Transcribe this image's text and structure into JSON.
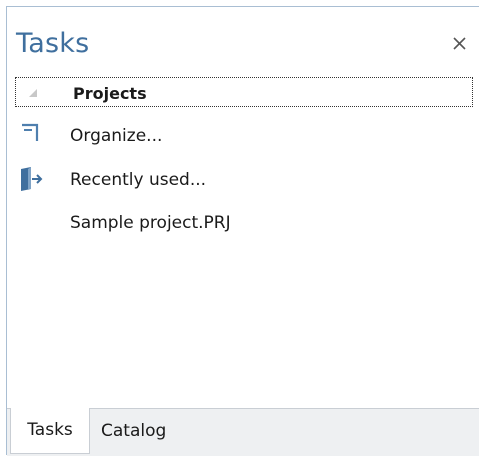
{
  "pane": {
    "title": "Tasks"
  },
  "group": {
    "label": "Projects",
    "expanded": true
  },
  "items": [
    {
      "label": "Organize...",
      "icon": "organize-icon"
    },
    {
      "label": "Recently used...",
      "icon": "recently-used-icon"
    },
    {
      "label": "Sample project.PRJ",
      "icon": ""
    }
  ],
  "tabs": [
    {
      "label": "Tasks",
      "selected": true
    },
    {
      "label": "Catalog",
      "selected": false
    }
  ],
  "colors": {
    "title": "#3f6f9e",
    "accent": "#4f7fae",
    "border": "#a9bed3",
    "tab_strip": "#eef0f2"
  }
}
